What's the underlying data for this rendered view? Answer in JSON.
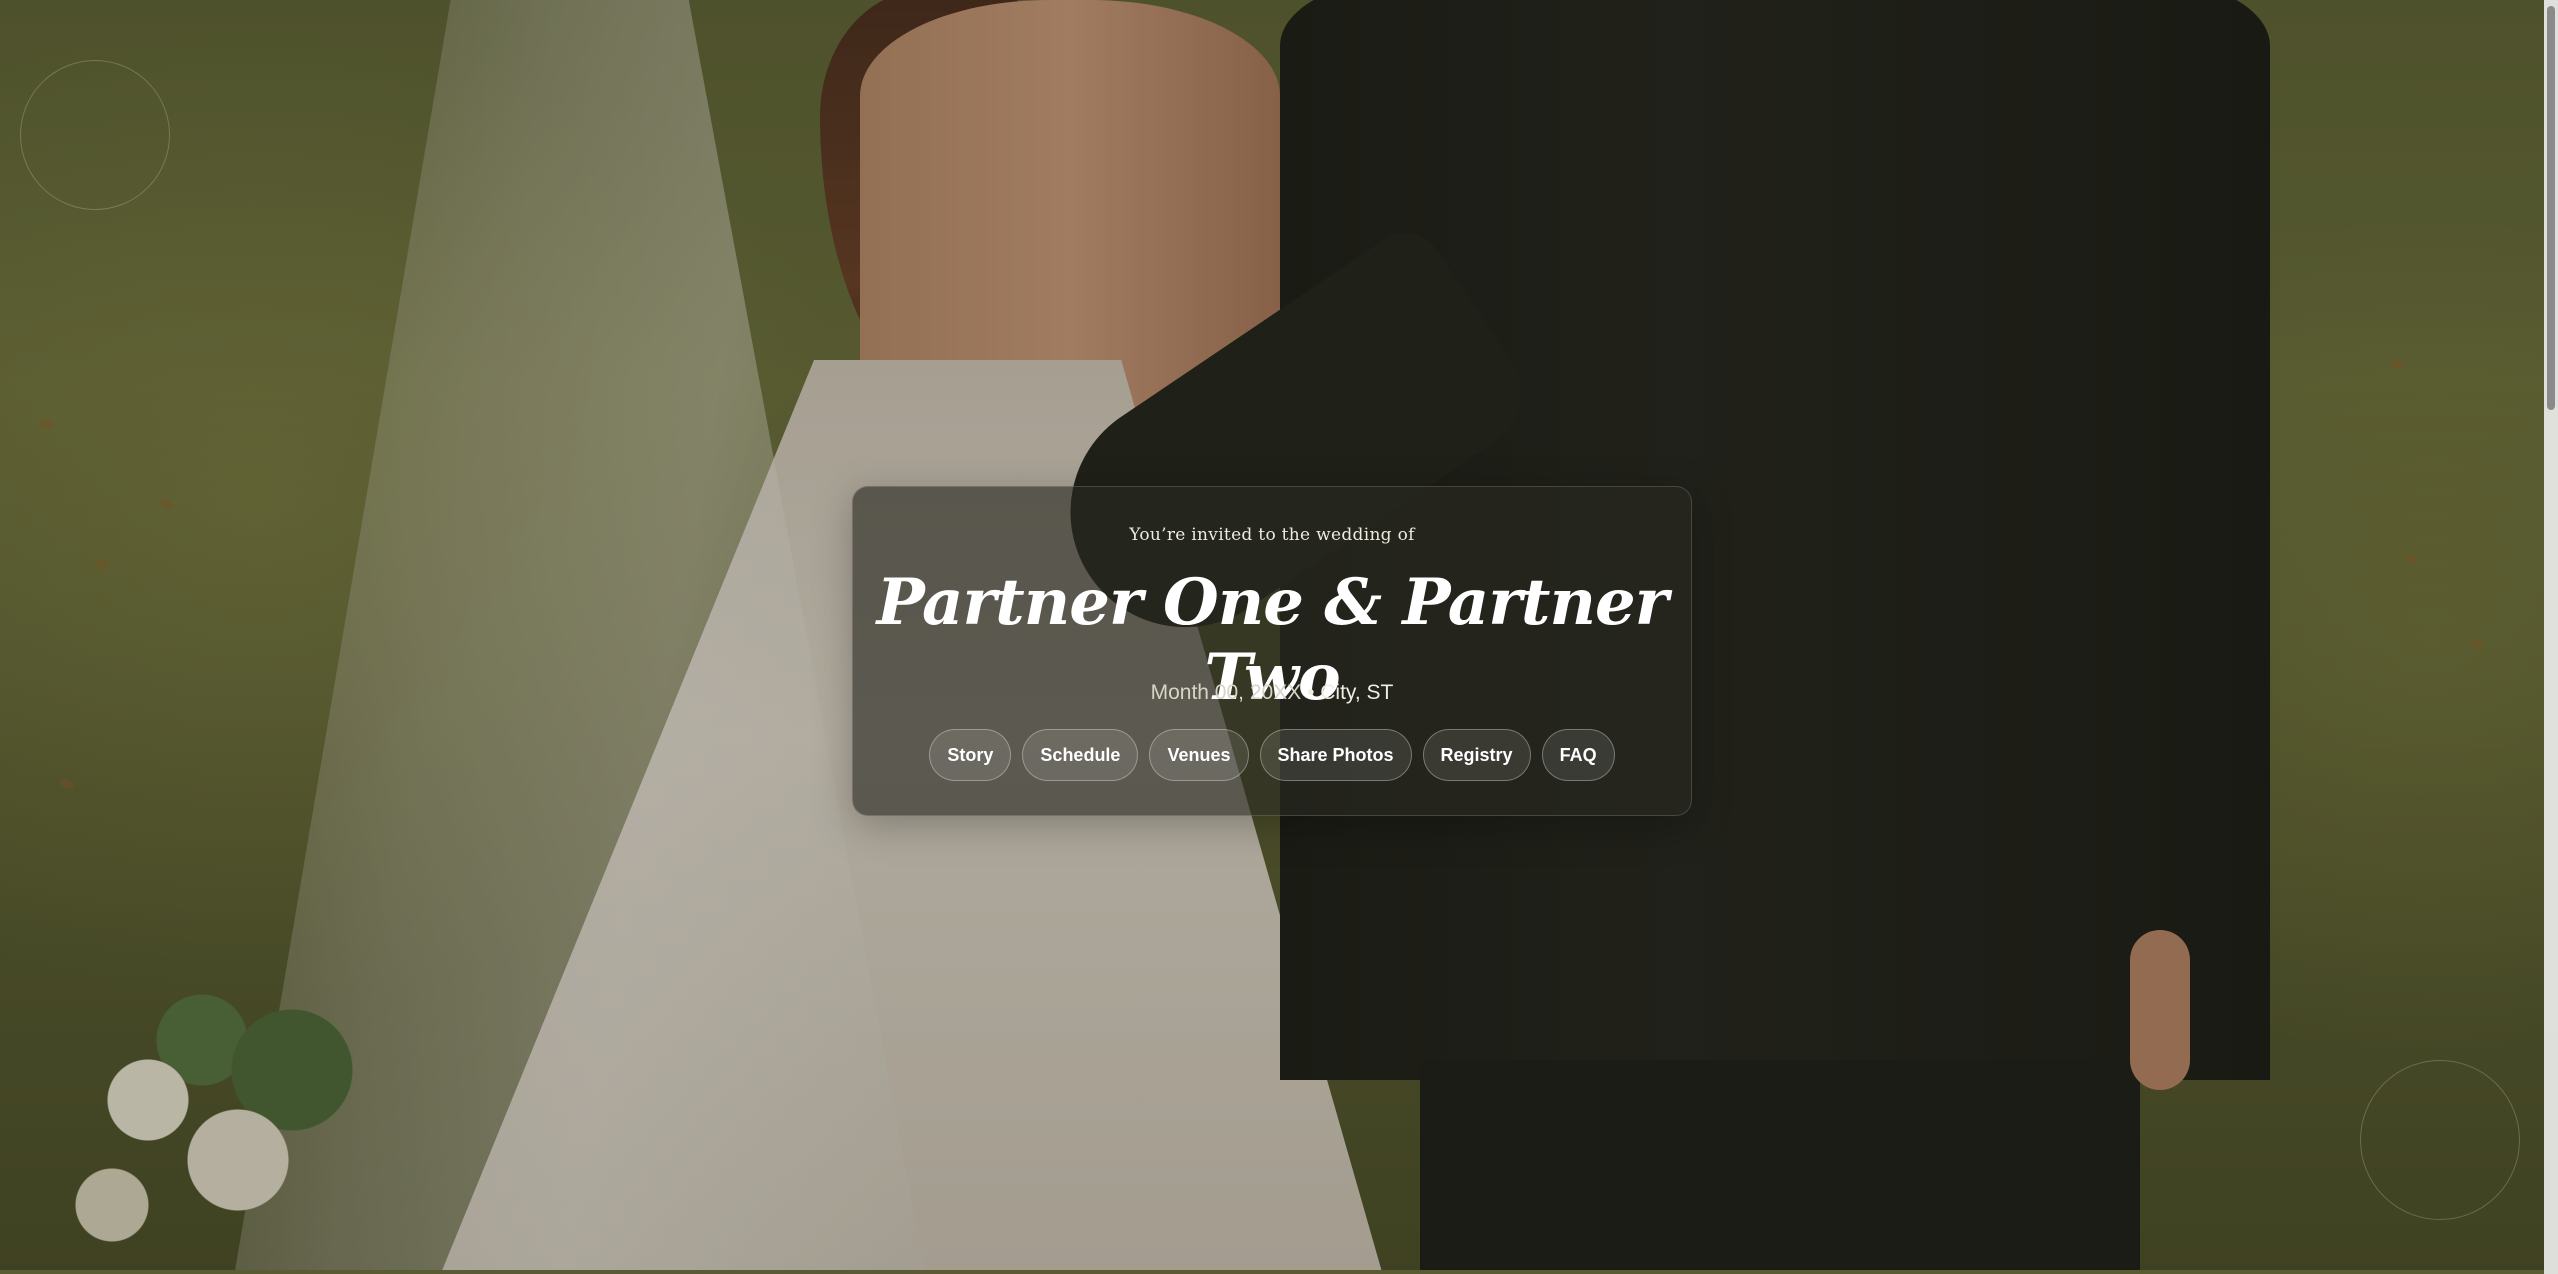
{
  "hero": {
    "invite_line": "You’re invited to the wedding of",
    "couple_names": "Partner One & Partner Two",
    "date": "Month 00, 20XX",
    "separator": "•",
    "location": "City, ST"
  },
  "nav": {
    "story": "Story",
    "schedule": "Schedule",
    "venues": "Venues",
    "share_photos": "Share Photos",
    "registry": "Registry",
    "faq": "FAQ"
  },
  "scroll": {
    "position_fraction": 0.0,
    "visible_fraction": 0.32
  },
  "colors": {
    "card_background": "#28281f",
    "button_border": "#ffffff",
    "lawn": "#6a6e3b"
  }
}
